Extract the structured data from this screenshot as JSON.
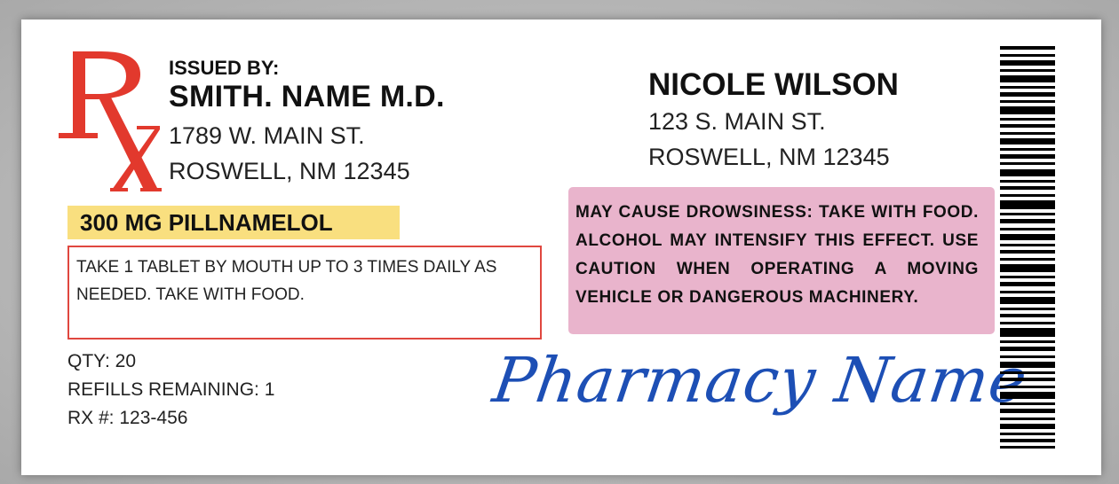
{
  "prescriber": {
    "issued_label": "ISSUED BY:",
    "name": "SMITH. NAME M.D.",
    "address_line1": "1789 W. MAIN ST.",
    "address_line2": "ROSWELL, NM 12345"
  },
  "rx_symbol": {
    "letters": "RX",
    "color": "#e2392d"
  },
  "medication": {
    "name": "300 MG PILLNAMELOL",
    "highlight_color": "#f9df7f",
    "instructions": "TAKE 1 TABLET BY MOUTH UP TO 3 TIMES DAILY AS NEEDED.  TAKE WITH FOOD."
  },
  "details": {
    "qty": "QTY: 20",
    "refills": "REFILLS REMAINING: 1",
    "rx_number": "RX #: 123-456"
  },
  "patient": {
    "name": "NICOLE WILSON",
    "address_line1": "123 S. MAIN ST.",
    "address_line2": "ROSWELL, NM 12345"
  },
  "warning": {
    "text": "MAY CAUSE DROWSINESS: TAKE WITH FOOD. ALCOHOL MAY INTENSIFY THIS EFFECT. USE CAUTION WHEN OPERATING A MOVING VEHICLE OR DANGEROUS MACHINERY.",
    "background_color": "#e9b4cc"
  },
  "pharmacy": {
    "name": "Pharmacy Name",
    "color": "#1d4fb5"
  },
  "barcode": {
    "icon": "barcode-icon"
  }
}
